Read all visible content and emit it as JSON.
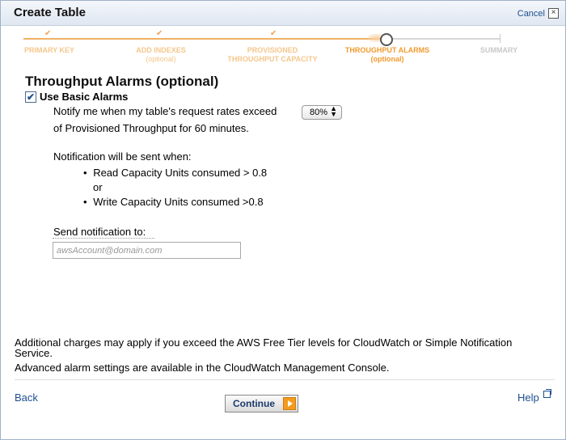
{
  "dialog": {
    "title": "Create Table",
    "cancel_label": "Cancel",
    "close_symbol": "×"
  },
  "steps": [
    {
      "label": "PRIMARY KEY",
      "sub": "",
      "state": "done"
    },
    {
      "label": "ADD INDEXES",
      "sub": "(optional)",
      "state": "done"
    },
    {
      "label": "PROVISIONED",
      "sub": "THROUGHPUT CAPACITY",
      "state": "done"
    },
    {
      "label": "THROUGHPUT ALARMS",
      "sub": "(optional)",
      "state": "current"
    },
    {
      "label": "SUMMARY",
      "sub": "",
      "state": "todo"
    }
  ],
  "content": {
    "heading": "Throughput Alarms (optional)",
    "use_basic_alarms_label": "Use Basic Alarms",
    "use_basic_alarms_checked": true,
    "notify_prefix": "Notify me when my table's request rates exceed",
    "threshold_selected": "80%",
    "notify_suffix": "of Provisioned Throughput for 60 minutes.",
    "notification_intro": "Notification will be sent when:",
    "read_condition": "Read Capacity Units consumed > 0.8",
    "or_label": "or",
    "write_condition": "Write Capacity Units consumed >0.8",
    "send_to_label": "Send notification to:",
    "email_placeholder": "awsAccount@domain.com"
  },
  "footer": {
    "charges_note": "Additional charges may apply if you exceed the AWS Free Tier levels for CloudWatch or Simple Notification Service.",
    "advanced_note": "Advanced alarm settings are available in the CloudWatch Management Console.",
    "back_label": "Back",
    "continue_label": "Continue",
    "help_label": "Help"
  },
  "colors": {
    "accent": "#f29a2e",
    "link": "#1f4f8f",
    "step_done": "#f5c68b"
  }
}
